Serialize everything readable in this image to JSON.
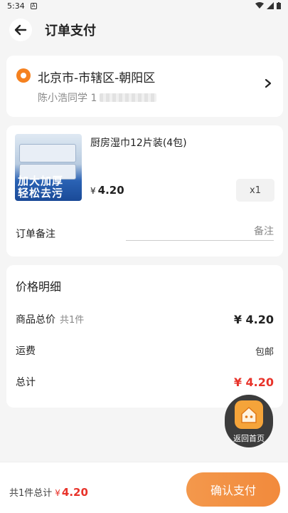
{
  "status_bar": {
    "time": "5:34",
    "badge": "A"
  },
  "header": {
    "title": "订单支付"
  },
  "address": {
    "main": "北京市-市辖区-朝阳区",
    "name": "陈小浩同学 1"
  },
  "product": {
    "name": "厨房湿巾12片装(4包)",
    "price_symbol": "¥",
    "price": "4.20",
    "quantity": "x1",
    "image_text_line1": "加大加厚",
    "image_text_line2": "轻松去污"
  },
  "note": {
    "label": "订单备注",
    "placeholder": "备注"
  },
  "price_detail": {
    "title": "价格明细",
    "subtotal_label": "商品总价",
    "subtotal_count": "共1件",
    "subtotal_value": "¥ 4.20",
    "shipping_label": "运费",
    "shipping_value": "包邮",
    "total_label": "总计",
    "total_value": "¥ 4.20"
  },
  "float_home": {
    "label": "返回首页"
  },
  "bottom_bar": {
    "summary_label": "共1件总计",
    "summary_symbol": "¥",
    "summary_value": "4.20",
    "pay_button": "确认支付"
  },
  "colors": {
    "accent": "#f28a3c",
    "price_red": "#e8332a",
    "background": "#f5f5f5"
  }
}
